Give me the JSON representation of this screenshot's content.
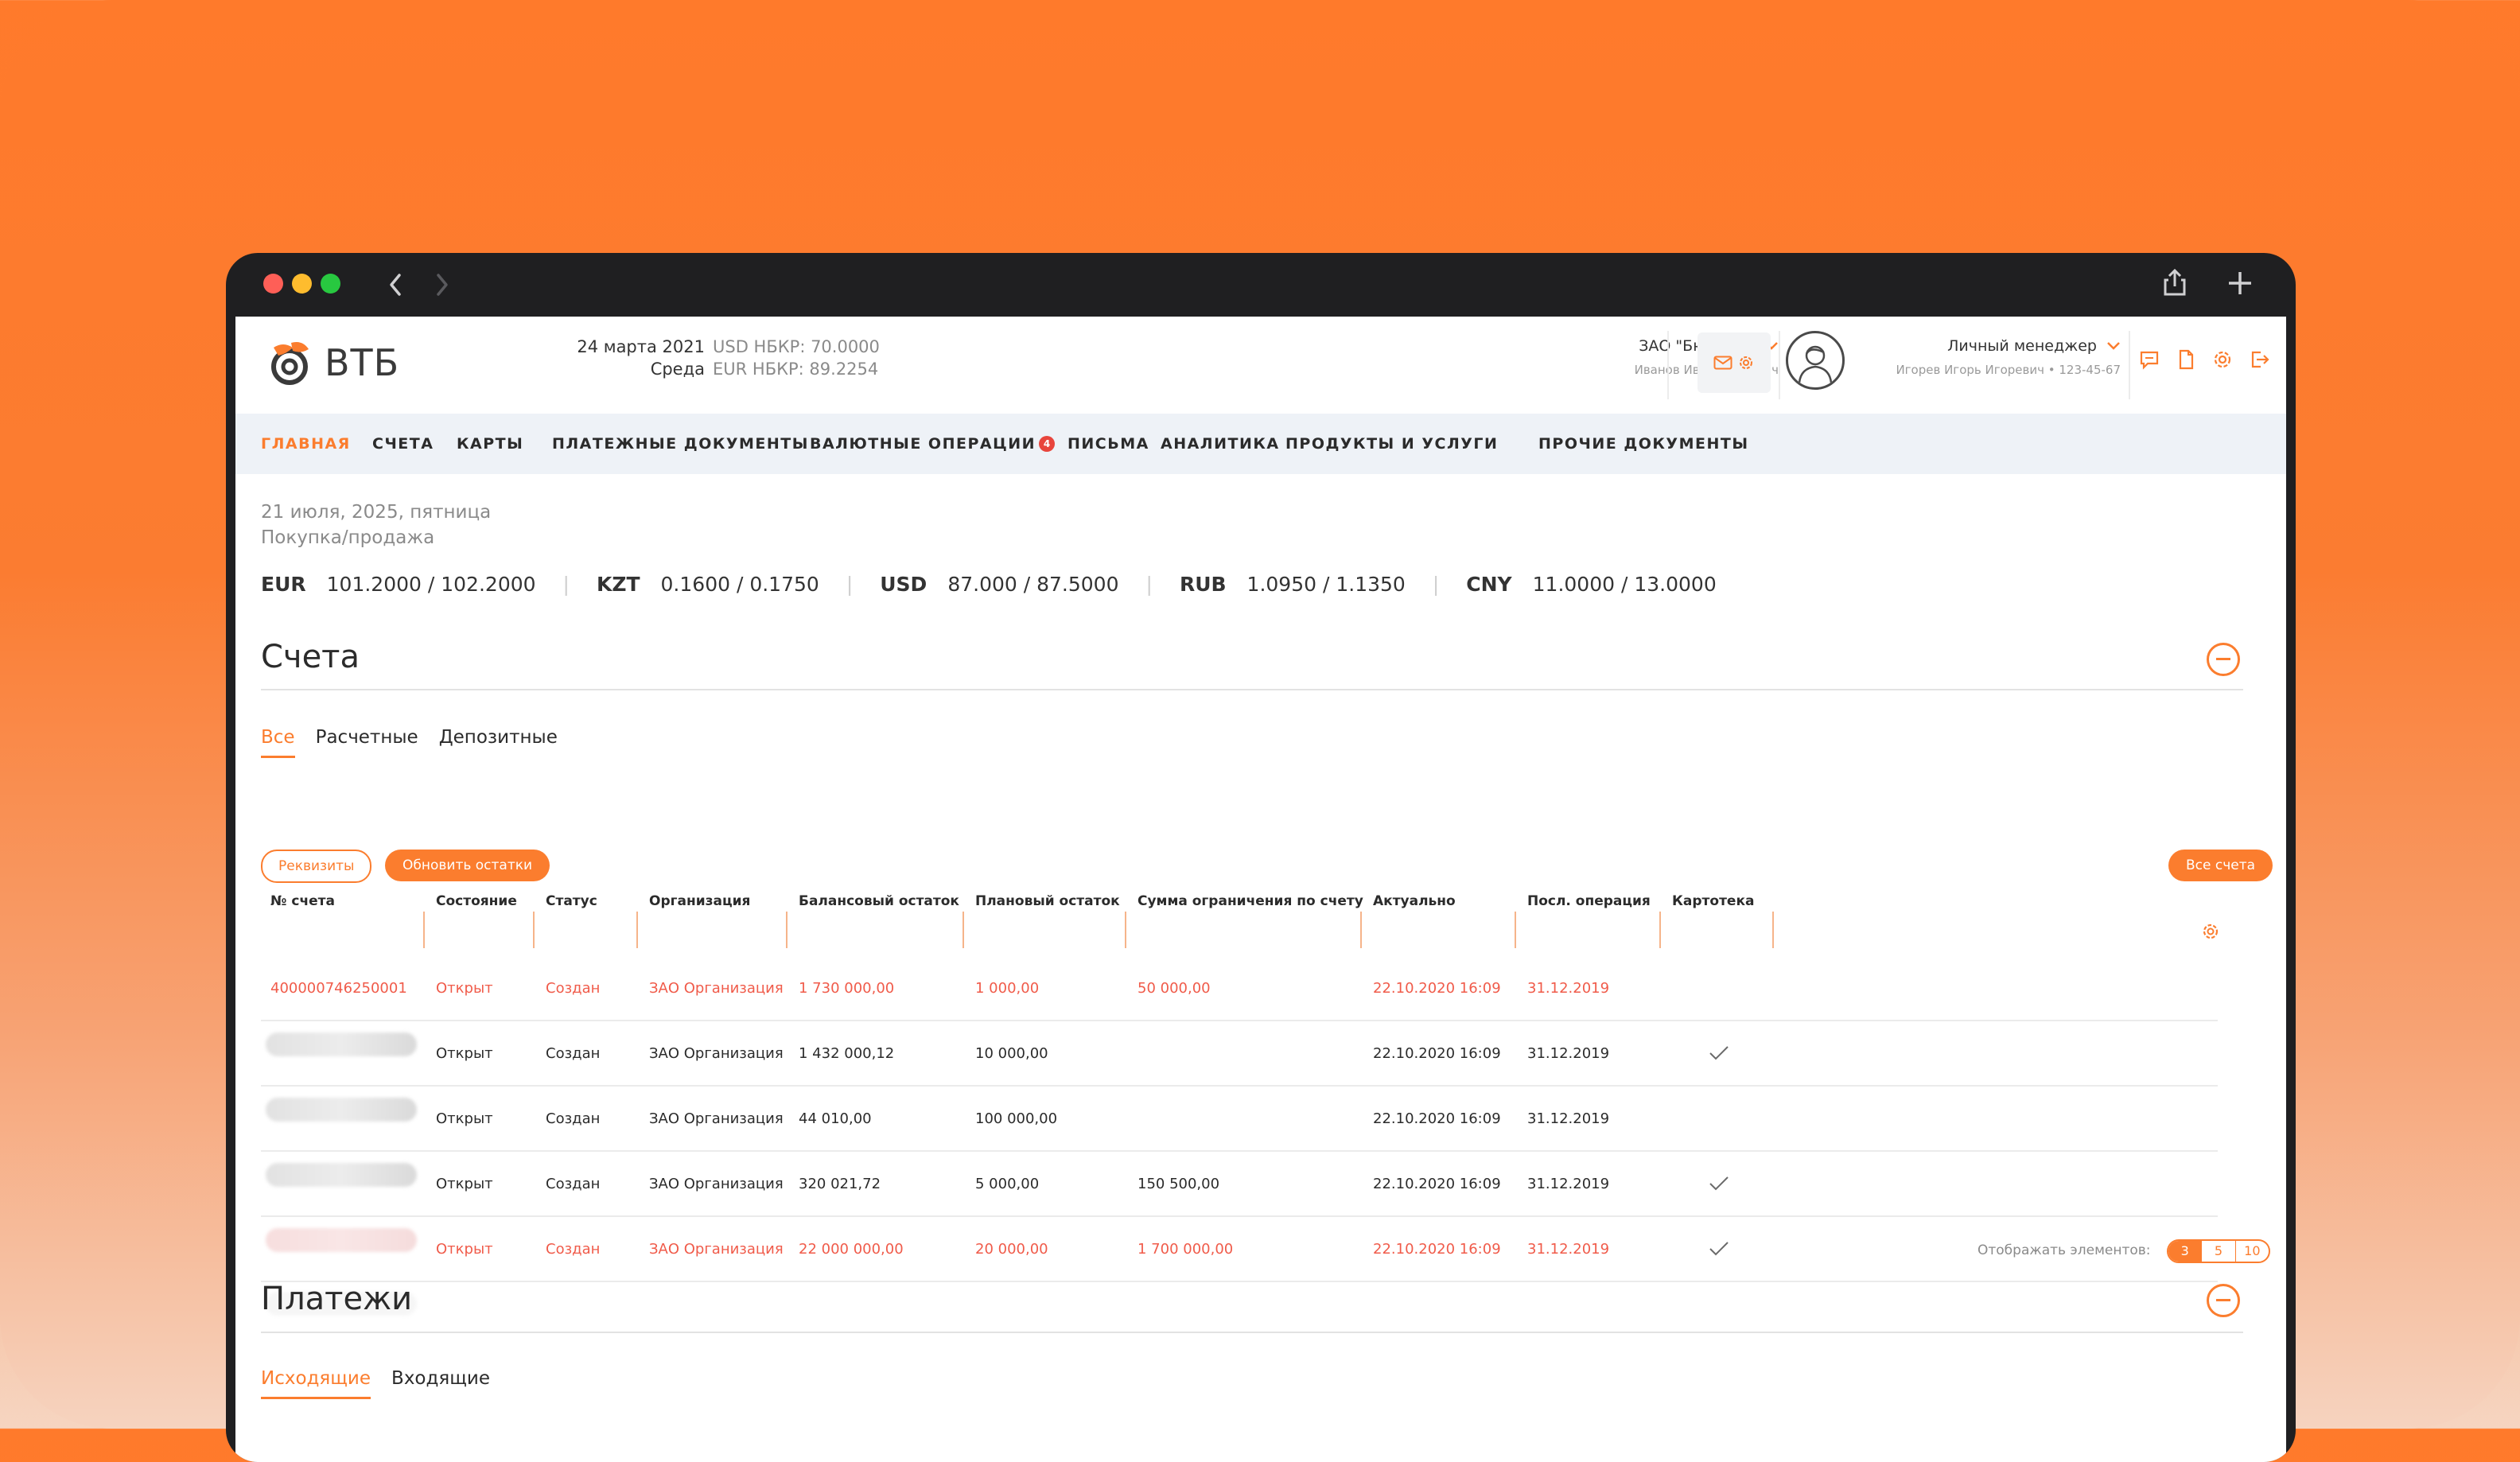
{
  "header": {
    "logo_text": "ВТБ",
    "date": "24 марта 2021",
    "weekday": "Среда",
    "usd_rate": "USD НБКР: 70.0000",
    "eur_rate": "EUR НБКР: 89.2254",
    "org_name": "ЗАО \"Бюджет\"",
    "org_user": "Иванов Иван Иванович",
    "manager_title": "Личный менеджер",
    "manager_sub": "Игорев Игорь Игоревич • 123-45-67"
  },
  "menu": [
    {
      "label": "ГЛАВНАЯ"
    },
    {
      "label": "СЧЕТА"
    },
    {
      "label": "КАРТЫ"
    },
    {
      "label": "ПЛАТЕЖНЫЕ ДОКУМЕНТЫ"
    },
    {
      "label": "ВАЛЮТНЫЕ ОПЕРАЦИИ",
      "badge": "4"
    },
    {
      "label": "ПИСЬМА"
    },
    {
      "label": "АНАЛИТИКА"
    },
    {
      "label": "ПРОДУКТЫ И УСЛУГИ"
    },
    {
      "label": "ПРОЧИЕ ДОКУМЕНТЫ"
    }
  ],
  "today": {
    "date": "21 июля, 2025, пятница",
    "subtitle": "Покупка/продажа"
  },
  "rates": [
    {
      "code": "EUR",
      "value": "101.2000 / 102.2000"
    },
    {
      "code": "KZT",
      "value": "0.1600 / 0.1750"
    },
    {
      "code": "USD",
      "value": "87.000 / 87.5000"
    },
    {
      "code": "RUB",
      "value": "1.0950 / 1.1350"
    },
    {
      "code": "CNY",
      "value": "11.0000 / 13.0000"
    }
  ],
  "accounts": {
    "title": "Счета",
    "tabs": [
      "Все",
      "Расчетные",
      "Депозитные"
    ],
    "btn_details": "Реквизиты",
    "btn_refresh": "Обновить остатки",
    "btn_all": "Все счета",
    "columns": [
      "№ счета",
      "Состояние",
      "Статус",
      "Организация",
      "Балансовый остаток",
      "Плановый остаток",
      "Сумма ограничения по счету",
      "Актуально",
      "Посл. операция",
      "Картотека"
    ],
    "rows": [
      {
        "account": "400000746250001",
        "state": "Открыт",
        "status": "Создан",
        "org": "ЗАО Организация",
        "balance": "1 730 000,00",
        "planned": "1 000,00",
        "limit": "50 000,00",
        "actual": "22.10.2020 16:09",
        "last_op": "31.12.2019"
      },
      {
        "account": "",
        "state": "Открыт",
        "status": "Создан",
        "org": "ЗАО Организация",
        "balance": "1 432 000,12",
        "planned": "10 000,00",
        "limit": "",
        "actual": "22.10.2020 16:09",
        "last_op": "31.12.2019"
      },
      {
        "account": "",
        "state": "Открыт",
        "status": "Создан",
        "org": "ЗАО Организация",
        "balance": "44 010,00",
        "planned": "100 000,00",
        "limit": "",
        "actual": "22.10.2020 16:09",
        "last_op": "31.12.2019"
      },
      {
        "account": "",
        "state": "Открыт",
        "status": "Создан",
        "org": "ЗАО Организация",
        "balance": "320 021,72",
        "planned": "5 000,00",
        "limit": "150 500,00",
        "actual": "22.10.2020 16:09",
        "last_op": "31.12.2019"
      },
      {
        "account": "",
        "state": "Открыт",
        "status": "Создан",
        "org": "ЗАО Организация",
        "balance": "22 000 000,00",
        "planned": "20 000,00",
        "limit": "1 700 000,00",
        "actual": "22.10.2020 16:09",
        "last_op": "31.12.2019"
      }
    ],
    "pager_label": "Отображать элементов:",
    "pager_options": [
      "3",
      "5",
      "10"
    ]
  },
  "payments": {
    "title": "Платежи",
    "tabs": [
      "Исходящие",
      "Входящие"
    ]
  },
  "colors": {
    "accent": "#fb7d2e",
    "danger": "#f05b4a"
  }
}
